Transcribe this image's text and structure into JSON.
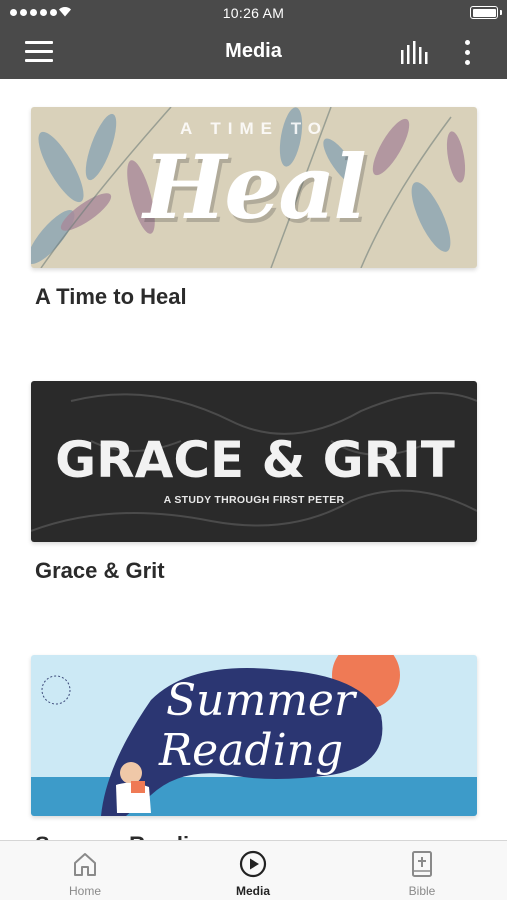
{
  "status_bar": {
    "time": "10:26 AM"
  },
  "header": {
    "title": "Media"
  },
  "icons": {
    "menu": "hamburger-menu-icon",
    "equalizer": "audio-bars-icon",
    "more": "vertical-ellipsis-icon"
  },
  "series": [
    {
      "title": "A Time to Heal",
      "banner": {
        "kicker": "A TIME TO",
        "headline": "Heal"
      },
      "colors": {
        "background": "#d9d1ba",
        "accent": "#8fa7b3"
      }
    },
    {
      "title": "Grace & Grit",
      "banner": {
        "headline": "GRACE & GRIT",
        "subheadline": "A STUDY THROUGH FIRST PETER"
      },
      "colors": {
        "background": "#2a2a2a"
      }
    },
    {
      "title": "Summer Reading",
      "banner": {
        "line1": "Summer",
        "line2": "Reading"
      },
      "colors": {
        "background": "#cce9f5",
        "blob": "#2b3672",
        "sun": "#ef7a55",
        "water": "#3d9bc9"
      }
    }
  ],
  "tabbar": {
    "tabs": [
      {
        "label": "Home",
        "icon": "home-icon",
        "active": false
      },
      {
        "label": "Media",
        "icon": "play-circle-icon",
        "active": true
      },
      {
        "label": "Bible",
        "icon": "bible-icon",
        "active": false
      }
    ]
  }
}
